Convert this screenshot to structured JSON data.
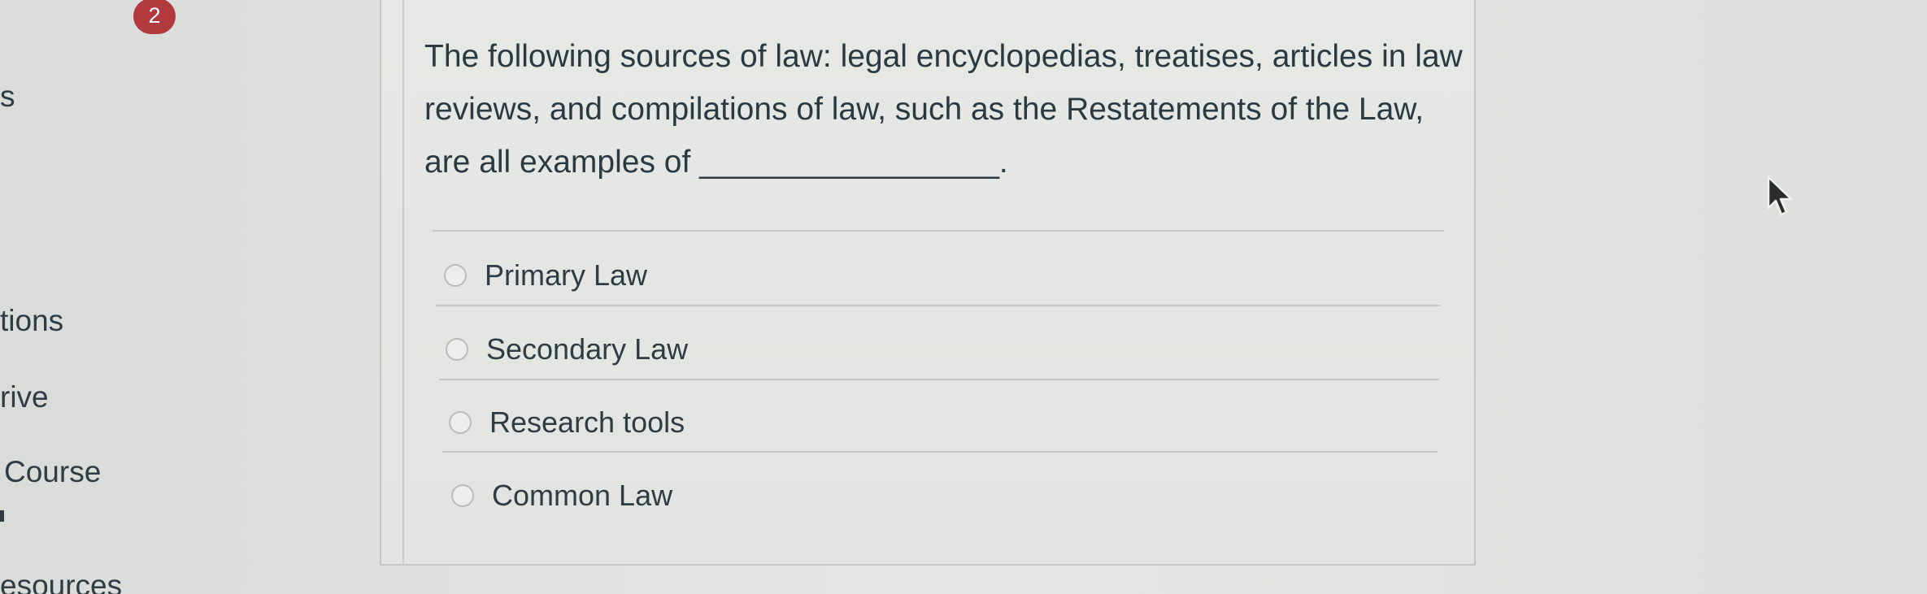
{
  "nav": {
    "badge": "2",
    "items": [
      "s",
      "tions",
      "rive",
      "Course",
      "esources"
    ]
  },
  "question": {
    "text": "The following sources of law: legal encyclopedias, treatises, articles in law reviews, and compilations of law, such as the Restatements of the Law, are all examples of _________________.",
    "answers": [
      "Primary Law",
      "Secondary Law",
      "Research tools",
      "Common Law"
    ]
  },
  "icons": {
    "cursor": "mouse-pointer-icon",
    "radio": "radio-button-icon"
  },
  "colors": {
    "badge": "#b23a3f",
    "text": "#2d3b45"
  }
}
